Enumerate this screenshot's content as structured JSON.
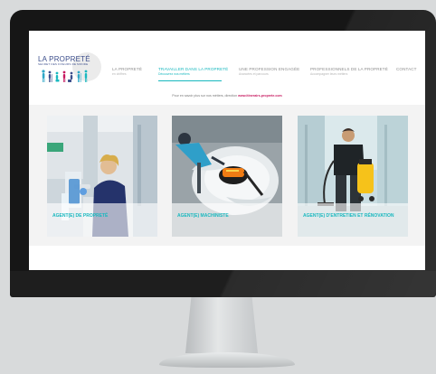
{
  "site": {
    "logo_title": "LA PROPRETÉ",
    "logo_subtitle": "SECRET DES FIXEURS DE MONDE"
  },
  "nav": {
    "items": [
      {
        "label": "LA PROPRETÉ",
        "sub": "en chiffres",
        "active": false
      },
      {
        "label": "TRAVAILLER DANS LA PROPRETÉ",
        "sub": "Découvrez nos métiers",
        "active": true
      },
      {
        "label": "UNE PROFESSION ENGAGÉE",
        "sub": "Avancées et parcours",
        "active": false
      },
      {
        "label": "PROFESSIONNELS DE LA PROPRETÉ",
        "sub": "Accompagner leurs métiers",
        "active": false
      },
      {
        "label": "CONTACT",
        "sub": "",
        "active": false
      }
    ]
  },
  "info": {
    "text": "Pour en savoir plus sur nos métiers, direction",
    "link": "www.itinerairs-proprete.com"
  },
  "cards": [
    {
      "title": "AGENT(E) DE PROPRETÉ"
    },
    {
      "title": "AGENT(E) MACHINISTE"
    },
    {
      "title": "AGENT(E) D'ENTRETIEN ET RÉNOVATION"
    }
  ],
  "colors": {
    "accent": "#19b8bf",
    "link": "#c7185f",
    "logo": "#3d4f8c"
  }
}
